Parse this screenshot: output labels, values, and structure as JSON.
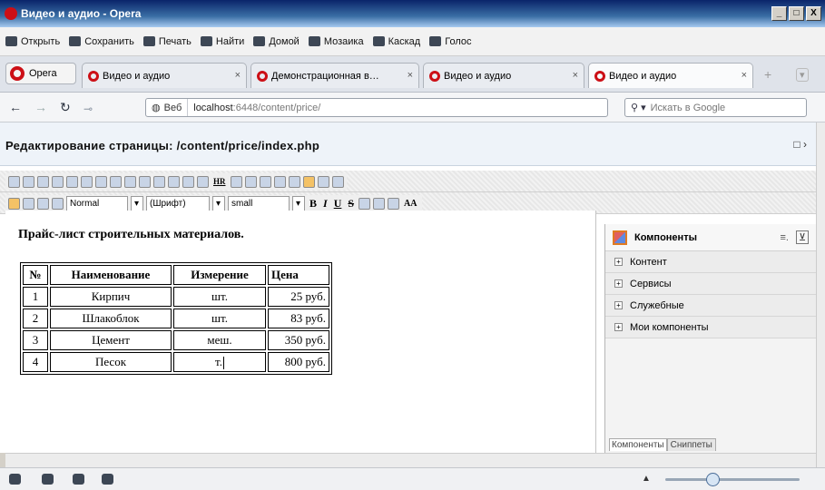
{
  "window": {
    "title": "Видео и аудио - Opera",
    "buttons": [
      "_",
      "□",
      "X"
    ]
  },
  "menu": [
    {
      "label": "Открыть",
      "icon": "folder-icon"
    },
    {
      "label": "Сохранить",
      "icon": "save-icon"
    },
    {
      "label": "Печать",
      "icon": "print-icon"
    },
    {
      "label": "Найти",
      "icon": "search-icon"
    },
    {
      "label": "Домой",
      "icon": "home-icon"
    },
    {
      "label": "Мозаика",
      "icon": "tile-icon"
    },
    {
      "label": "Каскад",
      "icon": "cascade-icon"
    },
    {
      "label": "Голос",
      "icon": "voice-icon"
    }
  ],
  "opera_label": "Opera",
  "tabs": [
    {
      "label": "Видео и аудио",
      "close": "×"
    },
    {
      "label": "Демонстрационная в…",
      "close": "×"
    },
    {
      "label": "Видео и аудио",
      "close": "×"
    },
    {
      "label": "Видео и аудио",
      "close": "×"
    }
  ],
  "address": {
    "mode": "Веб",
    "url_host": "localhost",
    "url_rest": ":6448/content/price/",
    "search_placeholder": "Искать в Google"
  },
  "page": {
    "heading": "Редактирование страницы: /content/price/index.php",
    "maximize": "□ ›"
  },
  "toolbar": {
    "style_select": "Normal",
    "font_select": "(Шрифт)",
    "size_select": "small",
    "bold": "B",
    "italic": "I",
    "underline": "U",
    "strike": "S",
    "hr": "HR",
    "aa": "AA"
  },
  "doc": {
    "title": "Прайс-лист строительных материалов.",
    "headers": [
      "№",
      "Наименование",
      "Измерение",
      "Цена"
    ],
    "rows": [
      [
        "1",
        "Кирпич",
        "шт.",
        "25 руб."
      ],
      [
        "2",
        "Шлакоблок",
        "шт.",
        "83 руб."
      ],
      [
        "3",
        "Цемент",
        "меш.",
        "350 руб."
      ],
      [
        "4",
        "Песок",
        "т.",
        "800 руб."
      ]
    ]
  },
  "panel": {
    "title": "Компоненты",
    "items": [
      "Контент",
      "Сервисы",
      "Служебные",
      "Мои компоненты"
    ],
    "tabs": [
      "Компоненты",
      "Сниппеты"
    ]
  }
}
